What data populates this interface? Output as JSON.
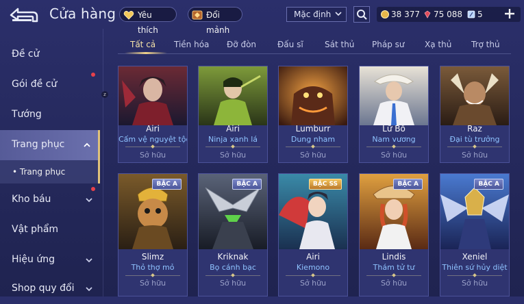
{
  "header": {
    "title": "Cửa hàng",
    "favorites_label": "Yêu thích",
    "exchange_label": "Đổi mảnh",
    "sort_label": "Mặc định",
    "currencies": [
      {
        "name": "gold",
        "value": "38 377"
      },
      {
        "name": "gems",
        "value": "75 088"
      },
      {
        "name": "vouchers",
        "value": "5"
      }
    ]
  },
  "sidebar": {
    "items": [
      {
        "label": "Đề cử"
      },
      {
        "label": "Gói đề cử"
      },
      {
        "label": "Tướng"
      },
      {
        "label": "Trang phục"
      },
      {
        "label": "Kho báu"
      },
      {
        "label": "Vật phẩm"
      },
      {
        "label": "Hiệu ứng"
      },
      {
        "label": "Shop quy đổi"
      }
    ],
    "sub_item": "• Trang phục"
  },
  "tabs": [
    "Tất cả",
    "Tiền hóa",
    "Đỡ đòn",
    "Đấu sĩ",
    "Sát thủ",
    "Pháp sư",
    "Xạ thủ",
    "Trợ thủ"
  ],
  "cards": [
    {
      "hero": "Airi",
      "skin": "Cấm vệ nguyệt tộc",
      "status": "Sở hữu",
      "badge": ""
    },
    {
      "hero": "Airi",
      "skin": "Ninja xanh lá",
      "status": "Sở hữu",
      "badge": ""
    },
    {
      "hero": "Lumburr",
      "skin": "Dung nham",
      "status": "Sở hữu",
      "badge": ""
    },
    {
      "hero": "Lữ Bố",
      "skin": "Nam vương",
      "status": "Sở hữu",
      "badge": ""
    },
    {
      "hero": "Raz",
      "skin": "Đại tù trưởng",
      "status": "Sở hữu",
      "badge": ""
    },
    {
      "hero": "Slimz",
      "skin": "Thỏ thợ mỏ",
      "status": "Sở hữu",
      "badge": "BẬC A"
    },
    {
      "hero": "Kriknak",
      "skin": "Bọ cánh bạc",
      "status": "Sở hữu",
      "badge": "BẬC A"
    },
    {
      "hero": "Airi",
      "skin": "Kiemono",
      "status": "Sở hữu",
      "badge": "BẬC SS"
    },
    {
      "hero": "Lindis",
      "skin": "Thám tử tư",
      "status": "Sở hữu",
      "badge": "BẬC A"
    },
    {
      "hero": "Xeniel",
      "skin": "Thiên sứ hủy diệt",
      "status": "Sở hữu",
      "badge": "BẬC A"
    }
  ],
  "colors": {
    "accent_gold": "#f0d28a",
    "skin_name": "#8fc3ff",
    "notification": "#e8414b"
  }
}
